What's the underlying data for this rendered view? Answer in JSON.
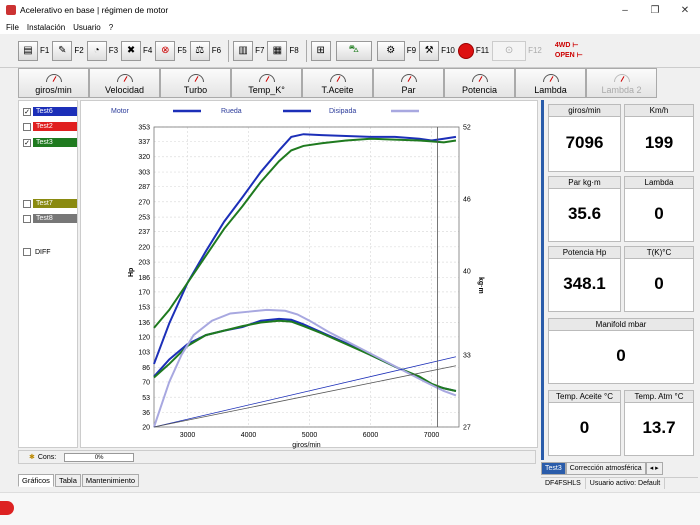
{
  "window": {
    "title": "Acelerativo en base | régimen de motor",
    "minimize": "–",
    "maximize": "❐",
    "close": "✕"
  },
  "menu": [
    "File",
    "Instalación",
    "Usuario",
    "?"
  ],
  "toolbar": [
    {
      "label": "F1",
      "icon": "run-chart-icon"
    },
    {
      "label": "F2",
      "icon": "chart-edit-icon"
    },
    {
      "label": "F3",
      "icon": "gauge-icon"
    },
    {
      "label": "F4",
      "icon": "chart-x-icon"
    },
    {
      "label": "F5",
      "icon": "alarm-icon"
    },
    {
      "label": "F6",
      "icon": "scale-icon"
    },
    {
      "label": "F7",
      "icon": "bar-chart-icon"
    },
    {
      "label": "F8",
      "icon": "grid-chart-icon"
    },
    {
      "label": "",
      "icon": "loadcell-icon"
    },
    {
      "label": "",
      "icon": "car-icon"
    },
    {
      "label": "F9",
      "icon": "wheels-icon"
    },
    {
      "label": "F10",
      "icon": "settings-chart-icon"
    },
    {
      "label": "F11",
      "icon": "record-icon"
    },
    {
      "label": "F12",
      "icon": "dyno-icon"
    }
  ],
  "drive_toggles": {
    "awd": "4WD ⊢",
    "open": "OPEN ⊢"
  },
  "gauge_tabs": [
    "giros/min",
    "Velocidad",
    "Turbo",
    "Temp_K°",
    "T.Aceite",
    "Par",
    "Potencia",
    "Lambda",
    "Lambda 2"
  ],
  "legend_tests": [
    {
      "name": "Test6",
      "checked": true,
      "color": "#1c2fb8"
    },
    {
      "name": "Test2",
      "checked": false,
      "color": "#e02020"
    },
    {
      "name": "Test3",
      "checked": true,
      "color": "#1f7a1f"
    },
    {
      "name": "Test7",
      "checked": false,
      "color": "#8a8a10"
    },
    {
      "name": "Test8",
      "checked": false,
      "color": "#777777"
    }
  ],
  "diff_label": "DIFF",
  "chart_data": {
    "type": "line",
    "legend": [
      {
        "name": "Motor",
        "color": "#1c2fb8"
      },
      {
        "name": "Rueda",
        "color": "#1c2fb8"
      },
      {
        "name": "Disipada",
        "color": "#a8a8e0"
      }
    ],
    "xlabel": "giros/min",
    "ylabel_left": "Hp",
    "ylabel_right": "kg·m",
    "xlim": [
      2450,
      7450
    ],
    "ylim_left": [
      20,
      353
    ],
    "ylim_right": [
      27,
      52
    ],
    "x_ticks": [
      3000,
      4000,
      5000,
      6000,
      7000
    ],
    "y_ticks_left": [
      20,
      36,
      53,
      70,
      86,
      103,
      120,
      136,
      153,
      170,
      186,
      203,
      220,
      237,
      253,
      270,
      287,
      303,
      320,
      337,
      353
    ],
    "y_ticks_right": [
      27,
      33,
      40,
      46,
      52
    ],
    "cursor_x": 7096,
    "series": [
      {
        "name": "Test6 Potencia",
        "color": "#1c2fb8",
        "axis": "left",
        "x": [
          2450,
          2700,
          3000,
          3300,
          3600,
          3900,
          4200,
          4500,
          4700,
          4900,
          5200,
          5600,
          6000,
          6400,
          6800,
          7000,
          7200,
          7400
        ],
        "y": [
          90,
          135,
          180,
          215,
          248,
          275,
          303,
          327,
          342,
          345,
          344,
          343,
          342,
          342,
          340,
          338,
          340,
          342
        ]
      },
      {
        "name": "Test3 Potencia",
        "color": "#1f7a1f",
        "axis": "left",
        "x": [
          2450,
          2700,
          3000,
          3300,
          3600,
          3900,
          4200,
          4500,
          4700,
          4900,
          5200,
          5600,
          6000,
          6400,
          6800,
          7000,
          7200,
          7400
        ],
        "y": [
          130,
          150,
          180,
          210,
          240,
          265,
          292,
          315,
          327,
          332,
          335,
          338,
          340,
          339,
          338,
          337,
          336,
          338
        ]
      },
      {
        "name": "Test6 Par",
        "color": "#1c2fb8",
        "axis": "left",
        "x": [
          2450,
          2700,
          3000,
          3300,
          3600,
          3900,
          4200,
          4500,
          4700,
          4900,
          5200,
          5600,
          6000,
          6400,
          6800,
          7000,
          7200,
          7400
        ],
        "y": [
          76,
          95,
          112,
          122,
          127,
          131,
          138,
          140,
          139,
          134,
          125,
          113,
          100,
          87,
          75,
          67,
          63,
          60
        ]
      },
      {
        "name": "Test3 Par",
        "color": "#1f7a1f",
        "axis": "left",
        "x": [
          2450,
          2700,
          3000,
          3300,
          3600,
          3900,
          4200,
          4500,
          4700,
          4900,
          5200,
          5600,
          6000,
          6400,
          6800,
          7000,
          7200,
          7400
        ],
        "y": [
          75,
          90,
          110,
          122,
          127,
          132,
          136,
          138,
          137,
          132,
          124,
          112,
          100,
          87,
          76,
          68,
          63,
          60
        ]
      },
      {
        "name": "Disipada Par",
        "color": "#a8a8e0",
        "axis": "left",
        "x": [
          2450,
          2550,
          2700,
          2900,
          3100,
          3400,
          3700,
          4000,
          4300,
          4600,
          4800,
          5000,
          5300,
          5700,
          6100,
          6500,
          6900,
          7200,
          7400
        ],
        "y": [
          20,
          40,
          70,
          100,
          122,
          138,
          146,
          148,
          150,
          149,
          145,
          138,
          126,
          112,
          98,
          84,
          70,
          60,
          55
        ]
      },
      {
        "name": "Disipada Motor",
        "color": "#1c2fb8",
        "axis": "left",
        "x": [
          2450,
          7400
        ],
        "y": [
          20,
          98
        ]
      },
      {
        "name": "Disipada Rueda",
        "color": "#555555",
        "axis": "left",
        "x": [
          2450,
          7400
        ],
        "y": [
          20,
          88
        ]
      }
    ]
  },
  "status": {
    "label": "Cons:",
    "progress": "0%"
  },
  "bottom_tabs": [
    "Gráficos",
    "Tabla",
    "Mantenimiento"
  ],
  "readouts": [
    {
      "label": "giros/min",
      "value": "7096"
    },
    {
      "label": "Km/h",
      "value": "199"
    },
    {
      "label": "Par kg·m",
      "value": "35.6"
    },
    {
      "label": "Lambda",
      "value": "0"
    },
    {
      "label": "Potencia Hp",
      "value": "348.1"
    },
    {
      "label": "T(K)°C",
      "value": "0"
    },
    {
      "label": "Manifold mbar",
      "value": "0"
    },
    {
      "label": "Temp. Aceite °C",
      "value": "0"
    },
    {
      "label": "Temp. Atm °C",
      "value": "13.7"
    }
  ],
  "right_tabs": [
    "Test3",
    "Corrección atmosférica"
  ],
  "right_status": [
    "DF4FSHLS",
    "Usuario activo: Default"
  ]
}
